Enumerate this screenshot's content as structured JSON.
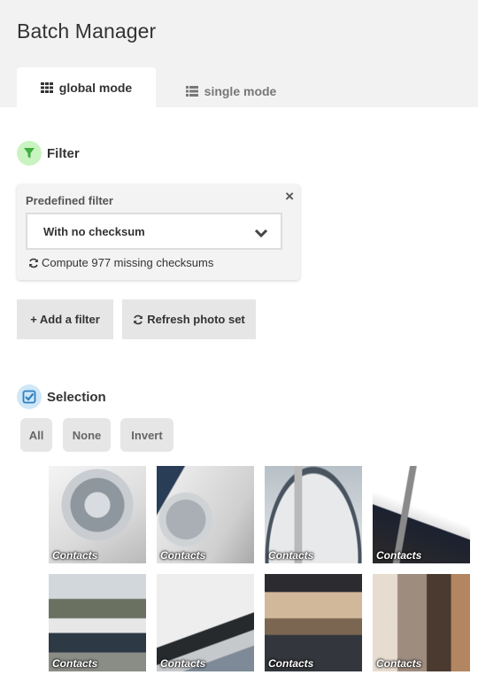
{
  "app": {
    "title": "Batch Manager"
  },
  "tabs": [
    {
      "label": "global mode",
      "icon": "grid-icon",
      "active": true
    },
    {
      "label": "single mode",
      "icon": "list-icon",
      "active": false
    }
  ],
  "filter_section": {
    "title": "Filter",
    "icon": "funnel-icon",
    "color": "#c9f3c1",
    "predefined": {
      "label": "Predefined filter",
      "selected": "With no checksum",
      "action": "Compute 977 missing checksums"
    },
    "add_filter_label": "+ Add a filter",
    "refresh_label": "Refresh photo set"
  },
  "selection_section": {
    "title": "Selection",
    "icon": "checkbox-icon",
    "color": "#cfe7f7",
    "buttons": {
      "all": "All",
      "none": "None",
      "invert": "Invert"
    }
  },
  "photos": [
    {
      "caption": "Contacts"
    },
    {
      "caption": "Contacts"
    },
    {
      "caption": "Contacts"
    },
    {
      "caption": "Contacts"
    },
    {
      "caption": "Contacts"
    },
    {
      "caption": "Contacts"
    },
    {
      "caption": "Contacts"
    },
    {
      "caption": "Contacts"
    }
  ]
}
